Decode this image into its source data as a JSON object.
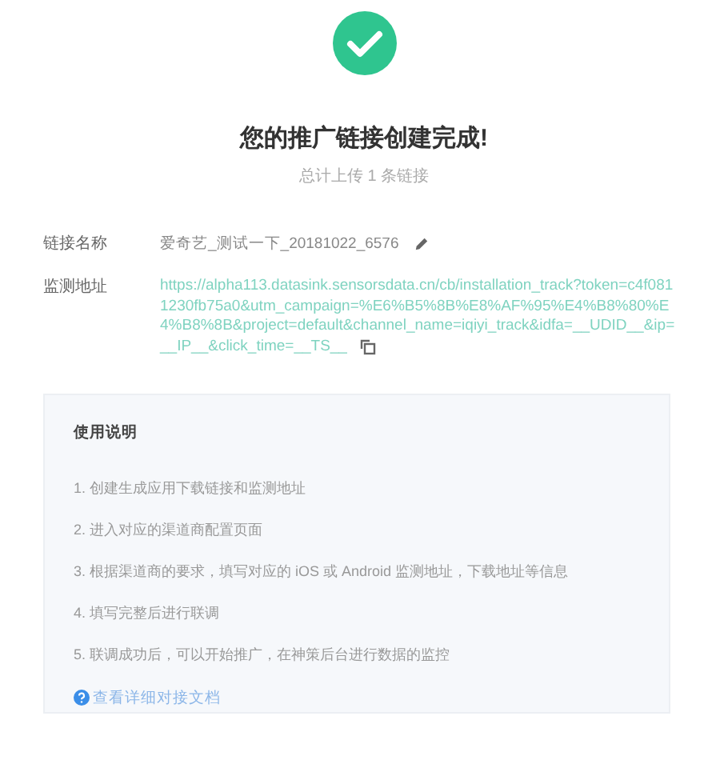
{
  "title": "您的推广链接创建完成!",
  "subtitle": "总计上传 1 条链接",
  "fields": [
    {
      "kind": "name",
      "label": "链接名称",
      "value": "爱奇艺_测试一下_20181022_6576"
    },
    {
      "kind": "url",
      "label": "监测地址",
      "value": "https://alpha113.datasink.sensorsdata.cn/cb/installation_track?token=c4f0811230fb75a0&utm_campaign=%E6%B5%8B%E8%AF%95%E4%B8%80%E4%B8%8B&project=default&channel_name=iqiyi_track&idfa=__UDID__&ip=__IP__&click_time=__TS__"
    }
  ],
  "instructions": {
    "heading": "使用说明",
    "steps": [
      "1. 创建生成应用下载链接和监测地址",
      "2. 进入对应的渠道商配置页面",
      "3. 根据渠道商的要求，填写对应的 iOS 或 Android 监测地址，下载地址等信息",
      "4. 填写完整后进行联调",
      "5. 联调成功后，可以开始推广，在神策后台进行数据的监控"
    ],
    "link": "查看详细对接文档"
  }
}
